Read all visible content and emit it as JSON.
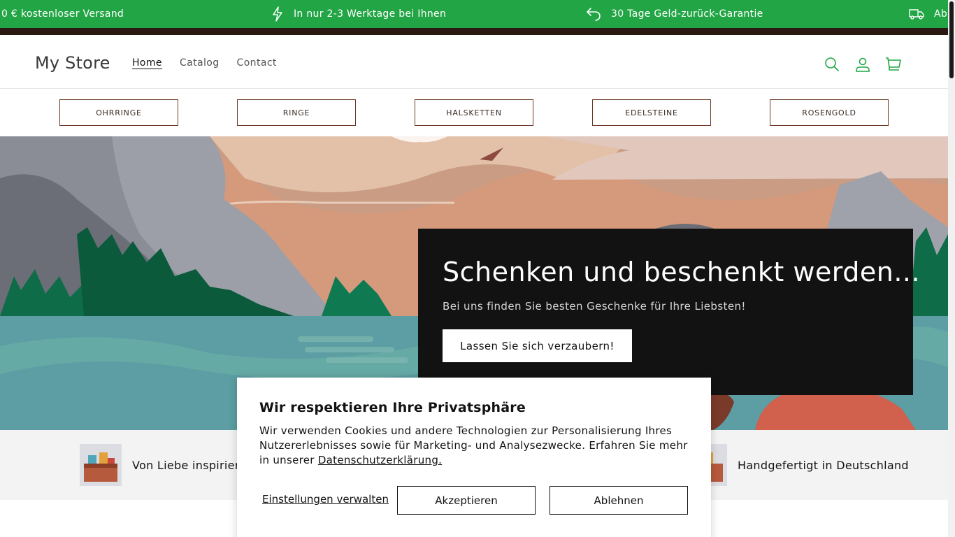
{
  "announcement": {
    "items": [
      {
        "text": "0 € kostenloser Versand",
        "icon": ""
      },
      {
        "text": "In nur 2-3 Werktage bei Ihnen",
        "icon": "lightning-icon"
      },
      {
        "text": "30 Tage Geld-zurück-Garantie",
        "icon": "return-arrow-icon"
      },
      {
        "text": "Ab",
        "icon": "truck-icon"
      }
    ],
    "bg_color": "#22a544"
  },
  "header": {
    "logo": "My Store",
    "nav": [
      {
        "label": "Home",
        "active": true
      },
      {
        "label": "Catalog",
        "active": false
      },
      {
        "label": "Contact",
        "active": false
      }
    ],
    "icons": [
      "search-icon",
      "account-icon",
      "cart-icon"
    ],
    "icon_color": "#22a544"
  },
  "categories": [
    "OHRRINGE",
    "RINGE",
    "HALSKETTEN",
    "EDELSTEINE",
    "ROSENGOLD"
  ],
  "hero": {
    "title": "Schenken und beschenkt werden...",
    "subtitle": "Bei uns finden Sie besten Geschenke für Ihre Liebsten!",
    "button": "Lassen Sie sich verzaubern!"
  },
  "features": [
    {
      "text": "Von Liebe inspiriert"
    },
    {
      "text": "Handgefertigt in Deutschland"
    }
  ],
  "cookie": {
    "title": "Wir respektieren Ihre Privatsphäre",
    "text": "Wir verwenden Cookies und andere Technologien zur Personalisierung Ihres Nutzererlebnisses sowie für Marketing- und Analysezwecke. Erfahren Sie mehr in unserer",
    "link": "Datenschutzerklärung.",
    "manage": "Einstellungen verwalten",
    "accept": "Akzeptieren",
    "decline": "Ablehnen"
  }
}
